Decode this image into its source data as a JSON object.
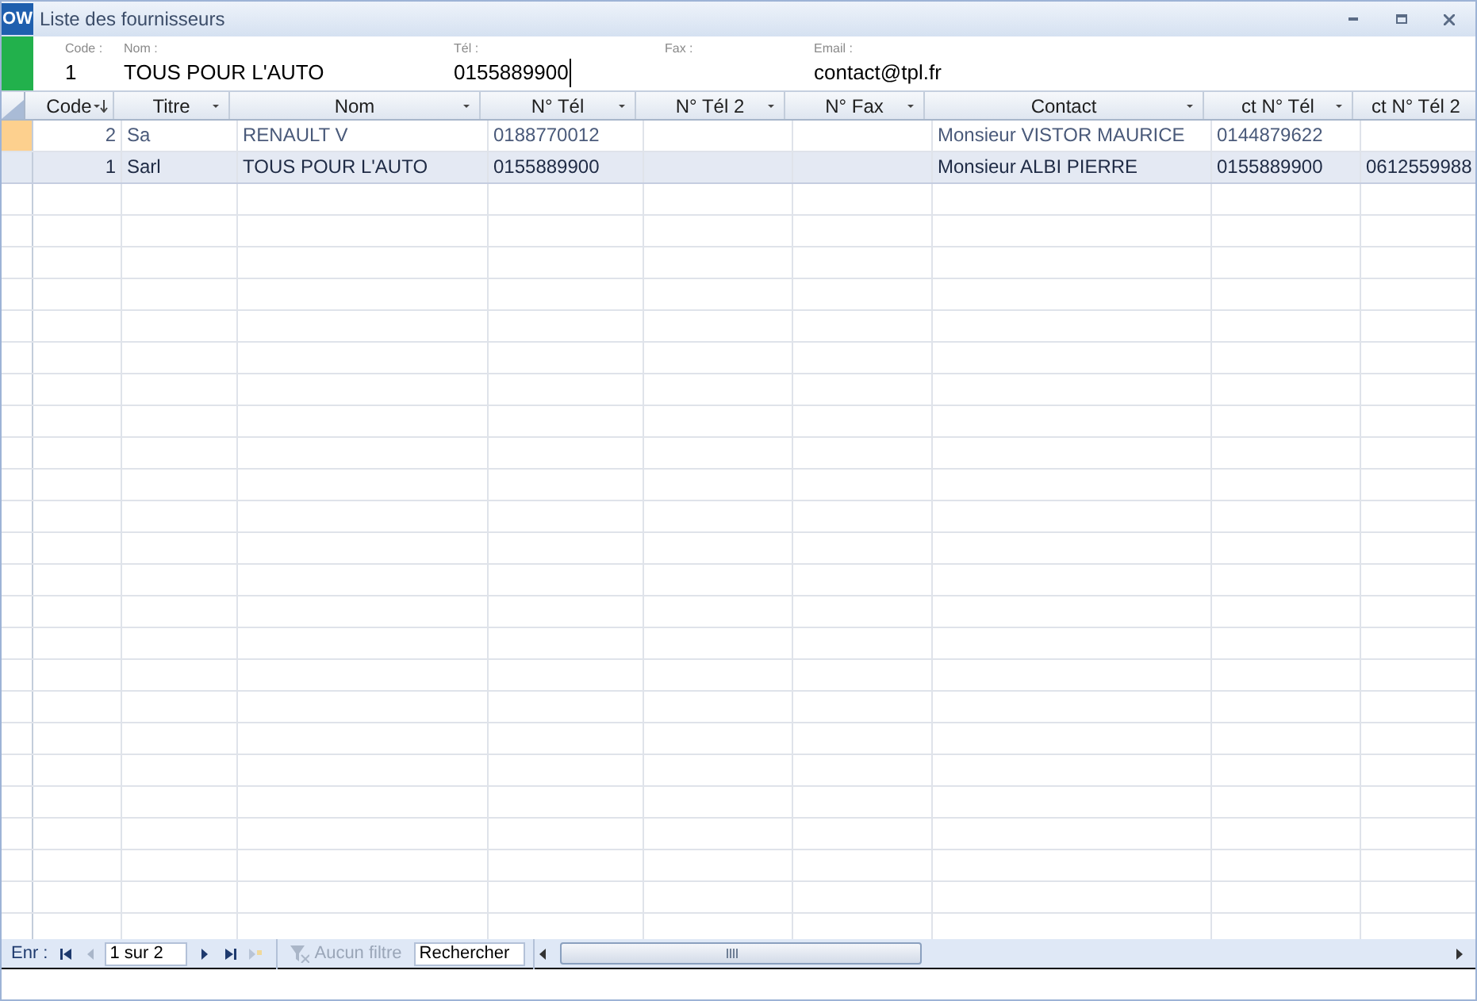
{
  "window": {
    "title": "Liste des fournisseurs",
    "app_badge": "OW"
  },
  "form": [
    {
      "label": "Code :",
      "value": "1",
      "focused": false
    },
    {
      "label": "Nom :",
      "value": "TOUS POUR L'AUTO",
      "focused": false
    },
    {
      "label": "Tél :",
      "value": "0155889900",
      "focused": true
    },
    {
      "label": "Fax :"
    },
    {
      "label": "Email :",
      "value": "contact@tpl.fr",
      "focused": false
    }
  ],
  "table": {
    "columns": [
      {
        "label": "Code",
        "sorted": true,
        "filter": true
      },
      {
        "label": "Titre",
        "sorted": false,
        "filter": true
      },
      {
        "label": "Nom",
        "sorted": false,
        "filter": true
      },
      {
        "label": "N° Tél",
        "sorted": false,
        "filter": true
      },
      {
        "label": "N° Tél 2",
        "sorted": false,
        "filter": true
      },
      {
        "label": "N° Fax",
        "sorted": false,
        "filter": true
      },
      {
        "label": "Contact",
        "sorted": false,
        "filter": true
      },
      {
        "label": "ct N° Tél",
        "sorted": false,
        "filter": true
      },
      {
        "label": "ct N° Tél 2",
        "sorted": false,
        "filter": false
      }
    ],
    "rows": [
      {
        "current": true,
        "selected": false,
        "cells": [
          "2",
          "Sa",
          "RENAULT V",
          "0188770012",
          "",
          "",
          "Monsieur VISTOR MAURICE",
          "0144879622",
          ""
        ]
      },
      {
        "current": false,
        "selected": true,
        "cells": [
          "1",
          "Sarl",
          "TOUS POUR L'AUTO",
          "0155889900",
          "",
          "",
          "Monsieur ALBI PIERRE",
          "0155889900",
          "0612559988"
        ]
      }
    ]
  },
  "navigation": {
    "label": "Enr :",
    "position": "1 sur 2",
    "filter": "Aucun filtre",
    "filter_active": false,
    "search_placeholder": "Rechercher"
  }
}
